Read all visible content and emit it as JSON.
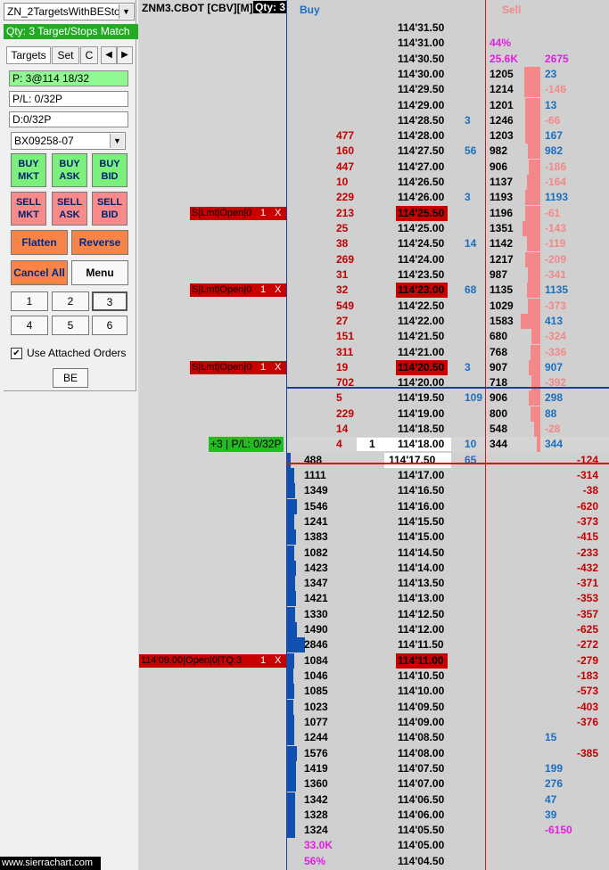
{
  "panel": {
    "symbol_select": "ZN_2TargetsWithBESto",
    "qty_banner": "Qty: 3 Target/Stops Match",
    "tabs": [
      "Targets",
      "Set",
      "C"
    ],
    "position": "P: 3@114 18/32",
    "pl": "P/L: 0/32P",
    "daily": "D:0/32P",
    "account": "BX09258-07",
    "buttons": {
      "buy_mkt": [
        "BUY",
        "MKT"
      ],
      "buy_ask": [
        "BUY",
        "ASK"
      ],
      "buy_bid": [
        "BUY",
        "BID"
      ],
      "sell_mkt": [
        "SELL",
        "MKT"
      ],
      "sell_ask": [
        "SELL",
        "ASK"
      ],
      "sell_bid": [
        "SELL",
        "BID"
      ],
      "flatten": "Flatten",
      "reverse": "Reverse",
      "cancel_all": "Cancel All",
      "menu": "Menu",
      "qty": [
        "1",
        "2",
        "3",
        "4",
        "5",
        "6"
      ],
      "be": "BE"
    },
    "use_attached": "Use Attached Orders",
    "use_attached_checked": true,
    "footer": "www.sierrachart.com"
  },
  "ladder": {
    "header_title": "ZNM3.CBOT [CBV][M]",
    "header_qty": "Qty: 3",
    "buy_label": "Buy",
    "sell_label": "Sell",
    "colors": {
      "bid_bar": "#1050b0",
      "ask_bar": "#f48888",
      "order_red": "#c80000",
      "buy_blue": "#1b6fbf",
      "sell_red": "#c40000",
      "magenta": "#e020e0"
    },
    "rows": [
      {
        "price": "114'31.50"
      },
      {
        "price": "114'31.00",
        "ask": "44%",
        "ask_c": "m"
      },
      {
        "price": "114'30.50",
        "ask": "25.6K",
        "ask_c": "m",
        "sv": "2675",
        "sv_c": "m"
      },
      {
        "price": "114'30.00",
        "ask": "1205",
        "bar": 0.13,
        "sv": "23",
        "sv_c": "b"
      },
      {
        "price": "114'29.50",
        "ask": "1214",
        "bar": 0.13,
        "sv": "-146",
        "sv_c": "p"
      },
      {
        "price": "114'29.00",
        "ask": "1201",
        "bar": 0.12,
        "sv": "13",
        "sv_c": "b"
      },
      {
        "price": "114'28.50",
        "bs": "3",
        "ask": "1246",
        "bar": 0.12,
        "sv": "-66",
        "sv_c": "p"
      },
      {
        "price": "114'28.00",
        "bidv": "477",
        "ask": "1203",
        "bar": 0.12,
        "sv": "167",
        "sv_c": "b"
      },
      {
        "price": "114'27.50",
        "bidv": "160",
        "bs": "56",
        "ask": "982",
        "bar": 0.1,
        "sv": "982",
        "sv_c": "b"
      },
      {
        "price": "114'27.00",
        "bidv": "447",
        "ask": "906",
        "bar": 0.09,
        "sv": "-186",
        "sv_c": "p"
      },
      {
        "price": "114'26.50",
        "bidv": "10",
        "ask": "1137",
        "bar": 0.11,
        "sv": "-164",
        "sv_c": "p"
      },
      {
        "price": "114'26.00",
        "bidv": "229",
        "bs": "3",
        "ask": "1193",
        "bar": 0.12,
        "sv": "1193",
        "sv_c": "b"
      },
      {
        "price": "114'25.50",
        "order": "S|Lmt|Open|0",
        "oq": "1",
        "bidv": "213",
        "ask": "1196",
        "bar": 0.12,
        "sv": "-61",
        "sv_c": "p",
        "ph": true
      },
      {
        "price": "114'25.00",
        "bidv": "25",
        "ask": "1351",
        "bar": 0.14,
        "sv": "-143",
        "sv_c": "p"
      },
      {
        "price": "114'24.50",
        "bidv": "38",
        "bs": "14",
        "ask": "1142",
        "bar": 0.11,
        "sv": "-119",
        "sv_c": "p"
      },
      {
        "price": "114'24.00",
        "bidv": "269",
        "ask": "1217",
        "bar": 0.12,
        "sv": "-209",
        "sv_c": "p"
      },
      {
        "price": "114'23.50",
        "bidv": "31",
        "ask": "987",
        "bar": 0.1,
        "sv": "-341",
        "sv_c": "p"
      },
      {
        "price": "114'23.00",
        "order": "S|Lmt|Open|0",
        "oq": "1",
        "bidv": "32",
        "bs": "68",
        "ask": "1135",
        "bar": 0.11,
        "sv": "1135",
        "sv_c": "b",
        "ph": true
      },
      {
        "price": "114'22.50",
        "bidv": "549",
        "ask": "1029",
        "bar": 0.1,
        "sv": "-373",
        "sv_c": "p"
      },
      {
        "price": "114'22.00",
        "bidv": "27",
        "ask": "1583",
        "bar": 0.16,
        "sv": "413",
        "sv_c": "b"
      },
      {
        "price": "114'21.50",
        "bidv": "151",
        "ask": "680",
        "bar": 0.07,
        "sv": "-324",
        "sv_c": "p"
      },
      {
        "price": "114'21.00",
        "bidv": "311",
        "ask": "768",
        "bar": 0.08,
        "sv": "-336",
        "sv_c": "p"
      },
      {
        "price": "114'20.50",
        "order": "S|Lmt|Open|0",
        "oq": "1",
        "bidv": "19",
        "bs": "3",
        "ask": "907",
        "bar": 0.09,
        "sv": "907",
        "sv_c": "b",
        "ph": true
      },
      {
        "price": "114'20.00",
        "bidv": "702",
        "ask": "718",
        "bar": 0.07,
        "sv": "-392",
        "sv_c": "p"
      },
      {
        "price": "114'19.50",
        "bidv": "5",
        "bs": "109",
        "ask": "906",
        "bar": 0.09,
        "sv": "298",
        "sv_c": "b"
      },
      {
        "price": "114'19.00",
        "bidv": "229",
        "ask": "800",
        "bar": 0.08,
        "sv": "88",
        "sv_c": "b"
      },
      {
        "price": "114'18.50",
        "bidv": "14",
        "ask": "548",
        "bar": 0.05,
        "sv": "-28",
        "sv_c": "p"
      },
      {
        "price": "114'18.00",
        "pos": "+3 | P/L: 0/32P",
        "bidv": "4",
        "last": "1",
        "bs": "10",
        "ask": "344",
        "bar": 0.03,
        "sv": "344",
        "sv_c": "b",
        "cur": true
      },
      {
        "price": "114'17.50",
        "bid": "488",
        "bidbar": 0.05,
        "bs": "65",
        "sv": "-124",
        "sv_c": "r",
        "white": true
      },
      {
        "price": "114'17.00",
        "bid": "1111",
        "bidbar": 0.11,
        "sv": "-314",
        "sv_c": "r"
      },
      {
        "price": "114'16.50",
        "bid": "1349",
        "bidbar": 0.13,
        "sv": "-38",
        "sv_c": "r"
      },
      {
        "price": "114'16.00",
        "bid": "1546",
        "bidbar": 0.15,
        "sv": "-620",
        "sv_c": "r"
      },
      {
        "price": "114'15.50",
        "bid": "1241",
        "bidbar": 0.12,
        "sv": "-373",
        "sv_c": "r"
      },
      {
        "price": "114'15.00",
        "bid": "1383",
        "bidbar": 0.14,
        "sv": "-415",
        "sv_c": "r"
      },
      {
        "price": "114'14.50",
        "bid": "1082",
        "bidbar": 0.11,
        "sv": "-233",
        "sv_c": "r"
      },
      {
        "price": "114'14.00",
        "bid": "1423",
        "bidbar": 0.14,
        "sv": "-432",
        "sv_c": "r"
      },
      {
        "price": "114'13.50",
        "bid": "1347",
        "bidbar": 0.13,
        "sv": "-371",
        "sv_c": "r"
      },
      {
        "price": "114'13.00",
        "bid": "1421",
        "bidbar": 0.14,
        "sv": "-353",
        "sv_c": "r"
      },
      {
        "price": "114'12.50",
        "bid": "1330",
        "bidbar": 0.13,
        "sv": "-357",
        "sv_c": "r"
      },
      {
        "price": "114'12.00",
        "bid": "1490",
        "bidbar": 0.15,
        "sv": "-625",
        "sv_c": "r"
      },
      {
        "price": "114'11.50",
        "bid": "2846",
        "bidbar": 0.28,
        "sv": "-272",
        "sv_c": "r"
      },
      {
        "price": "114'11.00",
        "order": "114'09.00|Open|0|TQ:3",
        "oq": "1",
        "bid": "1084",
        "bidbar": 0.11,
        "sv": "-279",
        "sv_c": "r",
        "ph": true
      },
      {
        "price": "114'10.50",
        "bid": "1046",
        "bidbar": 0.1,
        "sv": "-183",
        "sv_c": "r"
      },
      {
        "price": "114'10.00",
        "bid": "1085",
        "bidbar": 0.11,
        "sv": "-573",
        "sv_c": "r"
      },
      {
        "price": "114'09.50",
        "bid": "1023",
        "bidbar": 0.1,
        "sv": "-403",
        "sv_c": "r"
      },
      {
        "price": "114'09.00",
        "bid": "1077",
        "bidbar": 0.11,
        "sv": "-376",
        "sv_c": "r"
      },
      {
        "price": "114'08.50",
        "bid": "1244",
        "bidbar": 0.12,
        "sv": "15",
        "sv_c": "b"
      },
      {
        "price": "114'08.00",
        "bid": "1576",
        "bidbar": 0.16,
        "sv": "-385",
        "sv_c": "r"
      },
      {
        "price": "114'07.50",
        "bid": "1419",
        "bidbar": 0.14,
        "sv": "199",
        "sv_c": "b"
      },
      {
        "price": "114'07.00",
        "bid": "1360",
        "bidbar": 0.14,
        "sv": "276",
        "sv_c": "b"
      },
      {
        "price": "114'06.50",
        "bid": "1342",
        "bidbar": 0.13,
        "sv": "47",
        "sv_c": "b"
      },
      {
        "price": "114'06.00",
        "bid": "1328",
        "bidbar": 0.13,
        "sv": "39",
        "sv_c": "b"
      },
      {
        "price": "114'05.50",
        "bid": "1324",
        "bidbar": 0.13,
        "sv": "-6150",
        "sv_c": "m"
      },
      {
        "price": "114'05.00",
        "bid": "33.0K",
        "bid_c": "m"
      },
      {
        "price": "114'04.50",
        "bid": "56%",
        "bid_c": "m"
      }
    ]
  }
}
